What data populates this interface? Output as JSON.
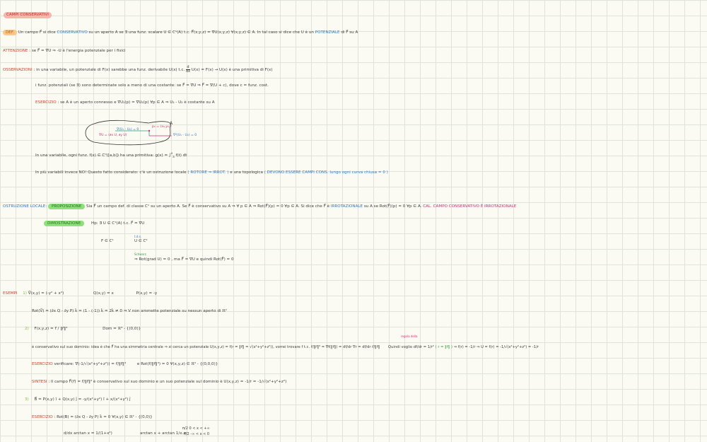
{
  "title": "CAMPI CONSERVATIVI",
  "l1": {
    "tag": "DEF.",
    "a": "Un campo F⃗ si dice",
    "b": "CONSERVATIVO",
    "c": "su un aperto A se ∃ una funz. scalare U ∈ C¹(A) t.c. F⃗(x,y,z) = ∇U(x,y,z) ∀(x,y,z) ∈ A. In tal caso si dice che U è un",
    "d": "POTENZIALE",
    "e": "di F⃗ su A"
  },
  "l2": {
    "tag": "ATTENZIONE",
    "a": ": se F⃗ = ∇U ⇒ -U è l'energia potenziale per i fisici"
  },
  "l3": {
    "tag": "OSSERVAZIONI",
    "a": ": in una variabile, un potenziale di F(x) sarebbe una funz. derivabile U(x) t.c.",
    "frac_n": "d",
    "frac_d": "dx",
    "b": "U(x) = F(x) → U(x) è una primitiva di F(x)"
  },
  "l4": {
    "a": "i funz. potenziali (se ∃) sono determinate solo a meno di una costante: se F⃗ = ∇U ⇒ F⃗ = ∇(U + c), dove c = funz. cost."
  },
  "l5": {
    "tag": "ESERCIZIO",
    "a": ": se A è un aperto connesso e ∇U₁(p) = ∇U₂(p) ∀p ∈ A ⇒ U₁ - U₂ è costante su A"
  },
  "fig": {
    "label_A": "A",
    "in1": "∇(U₁ - U₂) = 0",
    "in2": "∇U = (∂x U, ∂y U)",
    "in3": "p₀ = (x₀,y₀)",
    "in4": "∇²(U₁ - U₂) = 0"
  },
  "l6": {
    "a": "In una variabile, ogni funz. f(x) ∈ C⁰([a,b]) ha una primitiva: g(x) = ∫",
    "sub": "a",
    "sup": "x",
    "b": "f(t) dt"
  },
  "l7": {
    "a": "In più variabili invece NO! Questo fatto considerato: c'è un ostruzione locale",
    "b": "( ROTORE ⇒ IRROT. )",
    "c": "e una topologica",
    "d": "( DEVONO ESSERE CAMPI CONS. lungo ogni curva chiusa = 0 )"
  },
  "l8": {
    "tag": "OSTRUZIONE LOCALE:",
    "prop": "PROPOSIZIONE",
    "a": "Sia F⃗ un campo def. di classe C¹ su un aperto A. Se F⃗ è conservativo su A ⇒ ∀ p ∈ A ⇒ Rot(F⃗)(p) = 0 ∀p ∈ A. Si dice che F⃗ è",
    "b": "IRROTAZIONALE",
    "c": "su A se Rot(F⃗)(p) = 0 ∀p ∈ A.",
    "d": "CAL. CAMPO CONSERVATIVO È IRROTAZIONALE"
  },
  "l9": {
    "dim": "DIMOSTRAZIONE",
    "a": "Hp: ∃ U ∈ C¹(A) t.c. F⃗ = ∇U"
  },
  "l10": {
    "a": "F ∈ C¹",
    "over": "t.d.s.",
    "b": "U ∈ C²"
  },
  "l11": {
    "over": "Schwarz",
    "a": "⇒ Rot(grad U) = 0 , ma F⃗ = ∇U e quindi Rot(F⃗) = 0"
  },
  "l12": {
    "tag": "ESEMPI",
    "n": "1)",
    "a": "V⃗(x,y) = (-y² + x²)",
    "b": "Q(x,y) = x",
    "c": "P(x,y) = -y"
  },
  "l13": {
    "a": "Rot(V⃗) = (∂x Q - ∂y P) k̂ = (1 - (-1)) k̂ = 2k̂ ≠ 0 ⇒ V non ammette potenziale su nessun aperto di ℝ²"
  },
  "l14": {
    "n": "2)",
    "a": "F(x,y,z) = r⃗ / ‖r⃗‖³",
    "b": "Dom = ℝ³ - {(0,0)}"
  },
  "l15": {
    "a": "è conservativo sul suo dominio: idea è che F⃗ ha una simmetria centrale ⇒ si cerca un potenziale U(x,y,z) = f(r = ‖r⃗‖ = √(x²+y²+z²)), vorrei trovare f t.c. r⃗/‖r⃗‖³ = ∇f(‖r⃗‖) = df/dr ∇r = df/dr r⃗/‖r⃗‖",
    "note": "regola della",
    "c": "Quindi voglio df/dr = 1/r²",
    "d": "( r = ‖r⃗‖ )",
    "e": "⇒ f(r) = -1/r ⇒ U = f(r) = -1/√(x²+y²+z²) = -1/r"
  },
  "l16": {
    "tag": "ESERCIZIO",
    "a": "verificare: ∇(-1/√(x²+y²+z²)) = r⃗/‖r⃗‖³",
    "b": "e Rot(r⃗/‖r⃗‖³) = 0 ∀(x,y,z) ∈ ℝ³ - {(0,0,0)}"
  },
  "l17": {
    "tag": "SINTESI",
    "a": ": Il campo F⃗(r⃗) = r⃗/‖r⃗‖³ è conservativo sul suo dominio e un suo potenziale sul dominio è U(x,y,z) = -1/r = -1/√(x²+y²+z²)"
  },
  "l18": {
    "n": "3)",
    "a": "B⃗ = P(x,y) î + Q(x,y) ĵ = -y/(x²+y²) î + x/(x²+y²) ĵ"
  },
  "l19": {
    "tag": "ESERCIZIO",
    "a": ": Rot(B) = (∂x Q - ∂y P) k̂ = 0 ∀(x,y) ∈ ℝ² - {(0,0)}"
  },
  "l20": {
    "a": "d/dx arctan x = 1/(1+x²)",
    "b": "arctan x + arctan 1/x =",
    "c1": "π/2   0 < x < +∞",
    "c2": "-π/2   -∞ < x < 0"
  }
}
